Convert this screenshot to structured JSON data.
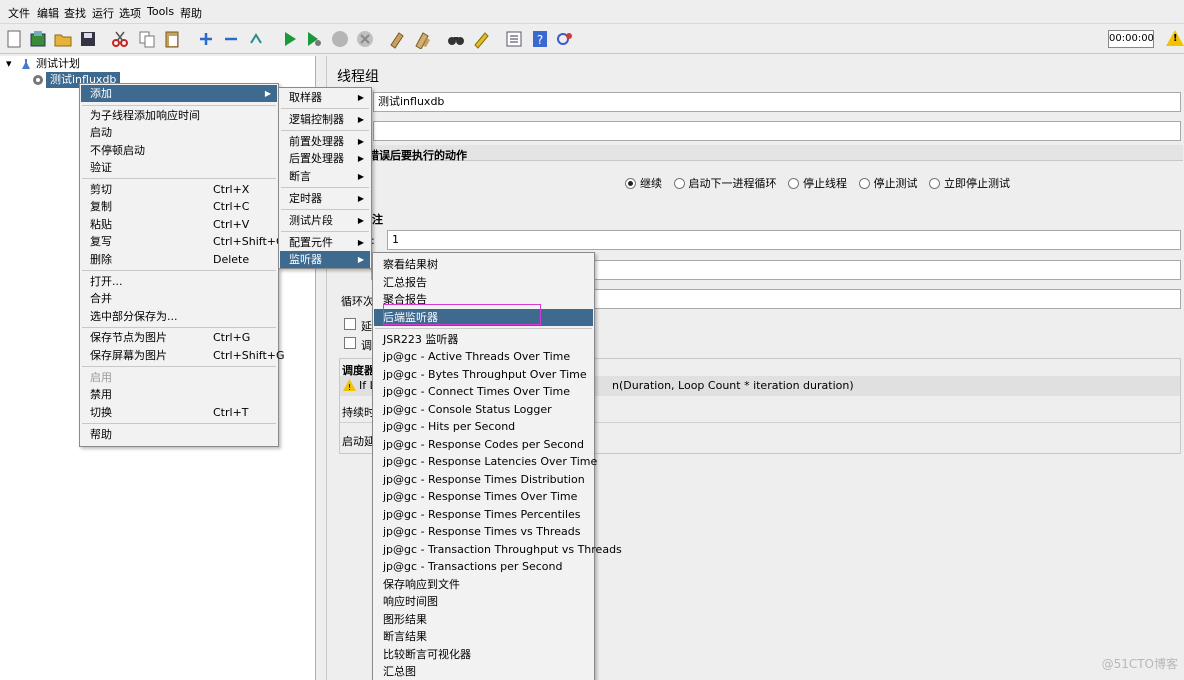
{
  "menubar": [
    "文件",
    "编辑",
    "查找",
    "运行",
    "选项",
    "Tools",
    "帮助"
  ],
  "toolbar": {
    "timer": "00:00:00"
  },
  "tree": {
    "root": "测试计划",
    "child": "测试influxdb"
  },
  "panel": {
    "title": "线程组",
    "name_value": "测试influxdb",
    "error_section": "器错误后要执行的动作",
    "radios": [
      "继续",
      "启动下一进程循环",
      "停止线程",
      "停止测试",
      "立即停止测试"
    ],
    "props_section": "注",
    "threads_label": ":",
    "threads_value": "1",
    "loop_label": "循环次",
    "delay_label": "延",
    "sched_label": "调",
    "scheduler_section": "调度器",
    "warning_prefix": "If L",
    "warning_suffix": "n(Duration, Loop Count * iteration duration)",
    "duration_label": "持续时",
    "startup_label": "启动延"
  },
  "context_menu": {
    "items": [
      {
        "label": "添加",
        "submenu": true,
        "selected": true
      },
      {
        "sep": true
      },
      {
        "label": "为子线程添加响应时间"
      },
      {
        "label": "启动"
      },
      {
        "label": "不停顿启动"
      },
      {
        "label": "验证"
      },
      {
        "sep": true
      },
      {
        "label": "剪切",
        "shortcut": "Ctrl+X"
      },
      {
        "label": "复制",
        "shortcut": "Ctrl+C"
      },
      {
        "label": "粘贴",
        "shortcut": "Ctrl+V"
      },
      {
        "label": "复写",
        "shortcut": "Ctrl+Shift+C"
      },
      {
        "label": "删除",
        "shortcut": "Delete"
      },
      {
        "sep": true
      },
      {
        "label": "打开..."
      },
      {
        "label": "合并"
      },
      {
        "label": "选中部分保存为..."
      },
      {
        "sep": true
      },
      {
        "label": "保存节点为图片",
        "shortcut": "Ctrl+G"
      },
      {
        "label": "保存屏幕为图片",
        "shortcut": "Ctrl+Shift+G"
      },
      {
        "sep": true
      },
      {
        "label": "启用",
        "disabled": true
      },
      {
        "label": "禁用"
      },
      {
        "label": "切换",
        "shortcut": "Ctrl+T"
      },
      {
        "sep": true
      },
      {
        "label": "帮助"
      }
    ]
  },
  "add_submenu": {
    "items": [
      {
        "label": "取样器",
        "submenu": true
      },
      {
        "sep": true
      },
      {
        "label": "逻辑控制器",
        "submenu": true
      },
      {
        "sep": true
      },
      {
        "label": "前置处理器",
        "submenu": true
      },
      {
        "label": "后置处理器",
        "submenu": true
      },
      {
        "label": "断言",
        "submenu": true
      },
      {
        "sep": true
      },
      {
        "label": "定时器",
        "submenu": true
      },
      {
        "sep": true
      },
      {
        "label": "测试片段",
        "submenu": true
      },
      {
        "sep": true
      },
      {
        "label": "配置元件",
        "submenu": true
      },
      {
        "label": "监听器",
        "submenu": true,
        "selected": true
      }
    ]
  },
  "listener_submenu": {
    "items": [
      {
        "label": "察看结果树"
      },
      {
        "label": "汇总报告"
      },
      {
        "label": "聚合报告"
      },
      {
        "label": "后端监听器",
        "selected": true
      },
      {
        "sep": true
      },
      {
        "label": "JSR223 监听器"
      },
      {
        "label": "jp@gc - Active Threads Over Time"
      },
      {
        "label": "jp@gc - Bytes Throughput Over Time"
      },
      {
        "label": "jp@gc - Connect Times Over Time"
      },
      {
        "label": "jp@gc - Console Status Logger"
      },
      {
        "label": "jp@gc - Hits per Second"
      },
      {
        "label": "jp@gc - Response Codes per Second"
      },
      {
        "label": "jp@gc - Response Latencies Over Time"
      },
      {
        "label": "jp@gc - Response Times Distribution"
      },
      {
        "label": "jp@gc - Response Times Over Time"
      },
      {
        "label": "jp@gc - Response Times Percentiles"
      },
      {
        "label": "jp@gc - Response Times vs Threads"
      },
      {
        "label": "jp@gc - Transaction Throughput vs Threads"
      },
      {
        "label": "jp@gc - Transactions per Second"
      },
      {
        "label": "保存响应到文件"
      },
      {
        "label": "响应时间图"
      },
      {
        "label": "图形结果"
      },
      {
        "label": "断言结果"
      },
      {
        "label": "比较断言可视化器"
      },
      {
        "label": "汇总图"
      }
    ]
  },
  "watermark": "@51CTO博客"
}
